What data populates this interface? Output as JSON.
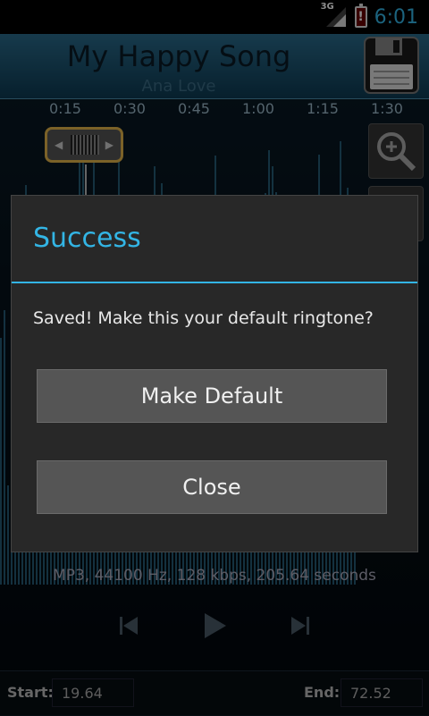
{
  "status_bar": {
    "network": "3G",
    "time": "6:01",
    "battery_warning": "!"
  },
  "song": {
    "title": "My Happy Song",
    "artist": "Ana Love"
  },
  "timeline": {
    "ticks": [
      "0:15",
      "0:30",
      "0:45",
      "1:00",
      "1:15",
      "1:30"
    ]
  },
  "info": "MP3, 44100 Hz, 128 kbps, 205.64 seconds",
  "bottom": {
    "start_label": "Start:",
    "start_value": "19.64",
    "end_label": "End:",
    "end_value": "72.52"
  },
  "dialog": {
    "title": "Success",
    "message": "Saved! Make this your default ringtone?",
    "primary_button": "Make Default",
    "secondary_button": "Close"
  },
  "colors": {
    "accent": "#33b5e5",
    "handle": "#e0b34a"
  }
}
